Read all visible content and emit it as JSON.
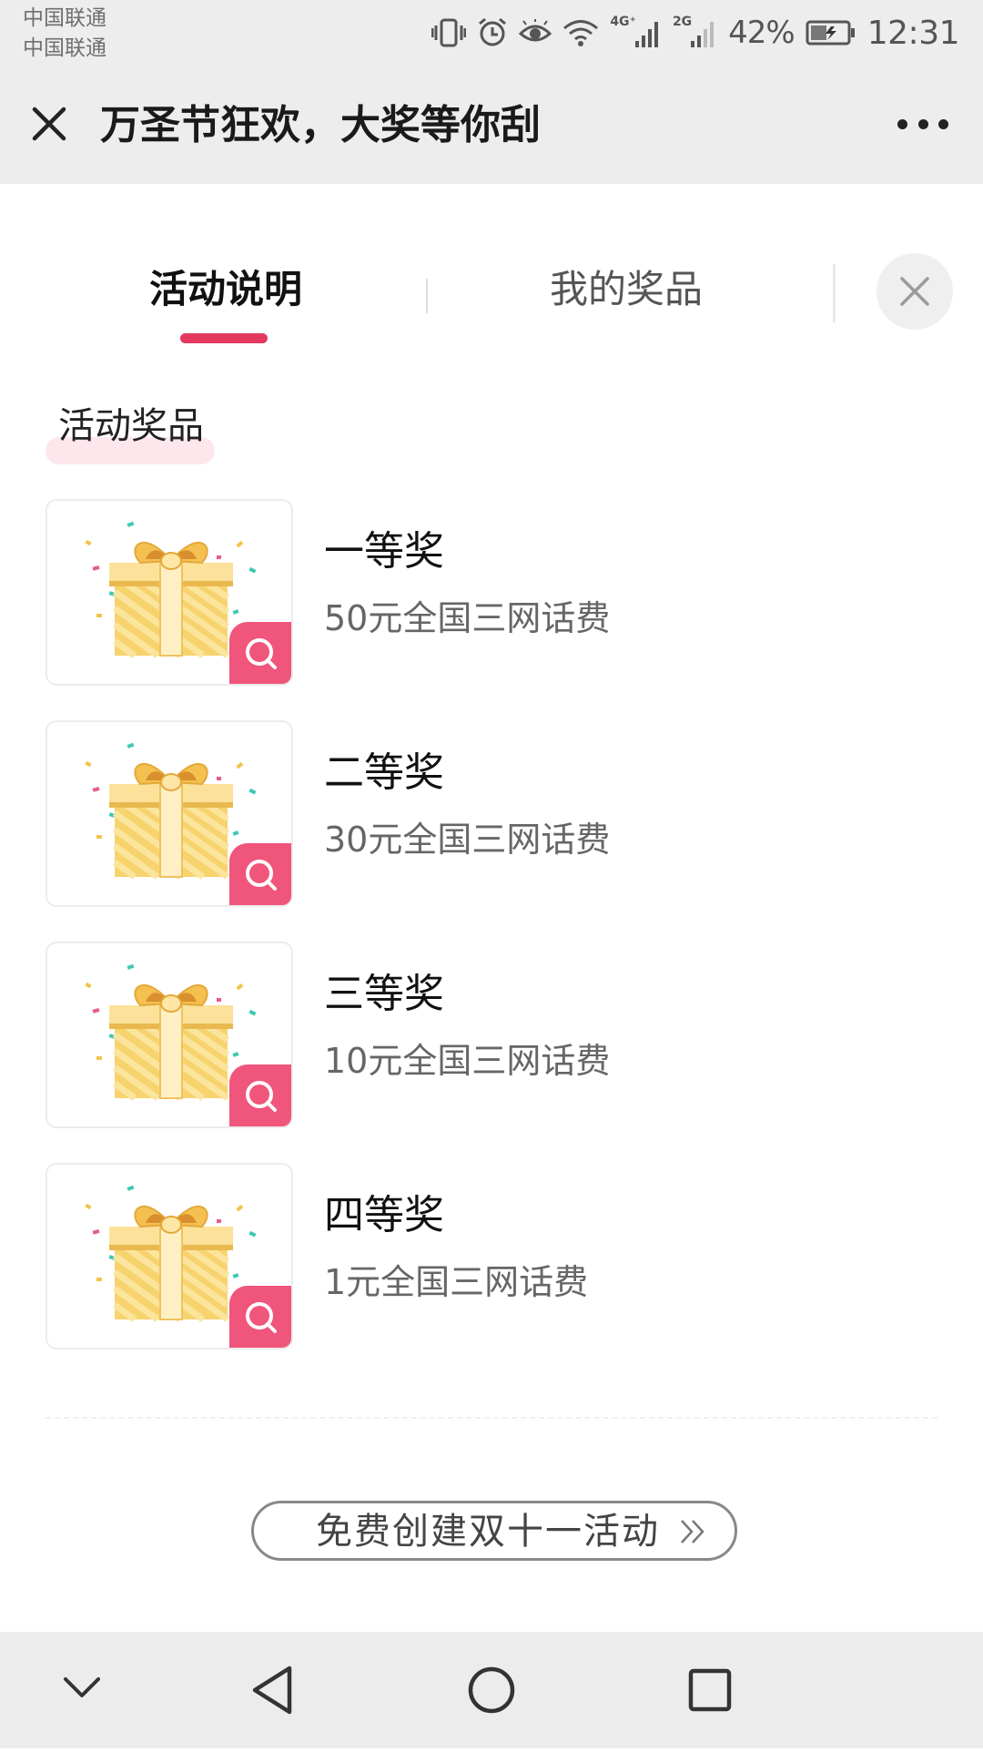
{
  "status_bar": {
    "carrier_1": "中国联通",
    "carrier_2": "中国联通",
    "net_1": "4G⁺",
    "net_2": "2G",
    "battery": "42%",
    "time": "12:31",
    "icons": [
      "vibrate-icon",
      "alarm-icon",
      "eye-icon",
      "wifi-icon",
      "signal-icon",
      "signal-icon",
      "battery-charging-icon"
    ]
  },
  "title_bar": {
    "title": "万圣节狂欢，大奖等你刮",
    "close_icon": "close-icon",
    "more_icon": "more-icon"
  },
  "tabs": {
    "items": [
      {
        "label": "活动说明",
        "active": true
      },
      {
        "label": "我的奖品",
        "active": false
      }
    ],
    "accent_color": "#e4395f"
  },
  "section": {
    "heading": "活动奖品"
  },
  "prizes": [
    {
      "name": "一等奖",
      "desc": "50元全国三网话费",
      "icon": "gift-icon"
    },
    {
      "name": "二等奖",
      "desc": "30元全国三网话费",
      "icon": "gift-icon"
    },
    {
      "name": "三等奖",
      "desc": "10元全国三网话费",
      "icon": "gift-icon"
    },
    {
      "name": "四等奖",
      "desc": "1元全国三网话费",
      "icon": "gift-icon"
    }
  ],
  "cta": {
    "label": "免费创建双十一活动",
    "icon": "double-chevron-right-icon"
  },
  "nav_bar": {
    "items": [
      "chevron-down-icon",
      "back-triangle-icon",
      "home-circle-icon",
      "recents-square-icon"
    ]
  },
  "colors": {
    "badge": "#f0557c",
    "highlight": "#fde7ec",
    "chrome_bg": "#ededed"
  }
}
